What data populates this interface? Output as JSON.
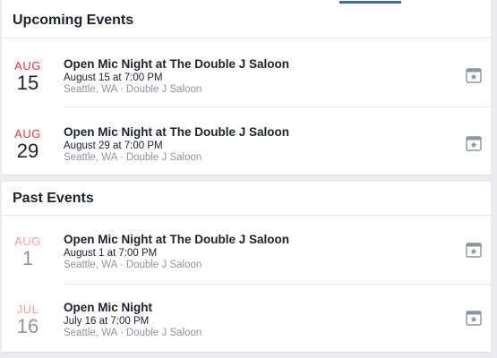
{
  "upcoming": {
    "heading": "Upcoming Events",
    "events": [
      {
        "month": "AUG",
        "day": "15",
        "title": "Open Mic Night at The Double J Saloon",
        "time": "August 15 at 7:00 PM",
        "place": "Seattle, WA · Double J Saloon"
      },
      {
        "month": "AUG",
        "day": "29",
        "title": "Open Mic Night at The Double J Saloon",
        "time": "August 29 at 7:00 PM",
        "place": "Seattle, WA · Double J Saloon"
      }
    ]
  },
  "past": {
    "heading": "Past Events",
    "events": [
      {
        "month": "AUG",
        "day": "1",
        "title": "Open Mic Night at The Double J Saloon",
        "time": "August 1 at 7:00 PM",
        "place": "Seattle, WA · Double J Saloon"
      },
      {
        "month": "JUL",
        "day": "16",
        "title": "Open Mic Night",
        "time": "July 16 at 7:00 PM",
        "place": "Seattle, WA · Double J Saloon"
      }
    ]
  },
  "icons": {
    "calendar_action": "calendar-star-icon"
  },
  "colors": {
    "accent": "#4267b2",
    "date_month_upcoming": "#e0393e",
    "date_month_past": "#f2a0a2",
    "muted_text": "#90949c"
  }
}
